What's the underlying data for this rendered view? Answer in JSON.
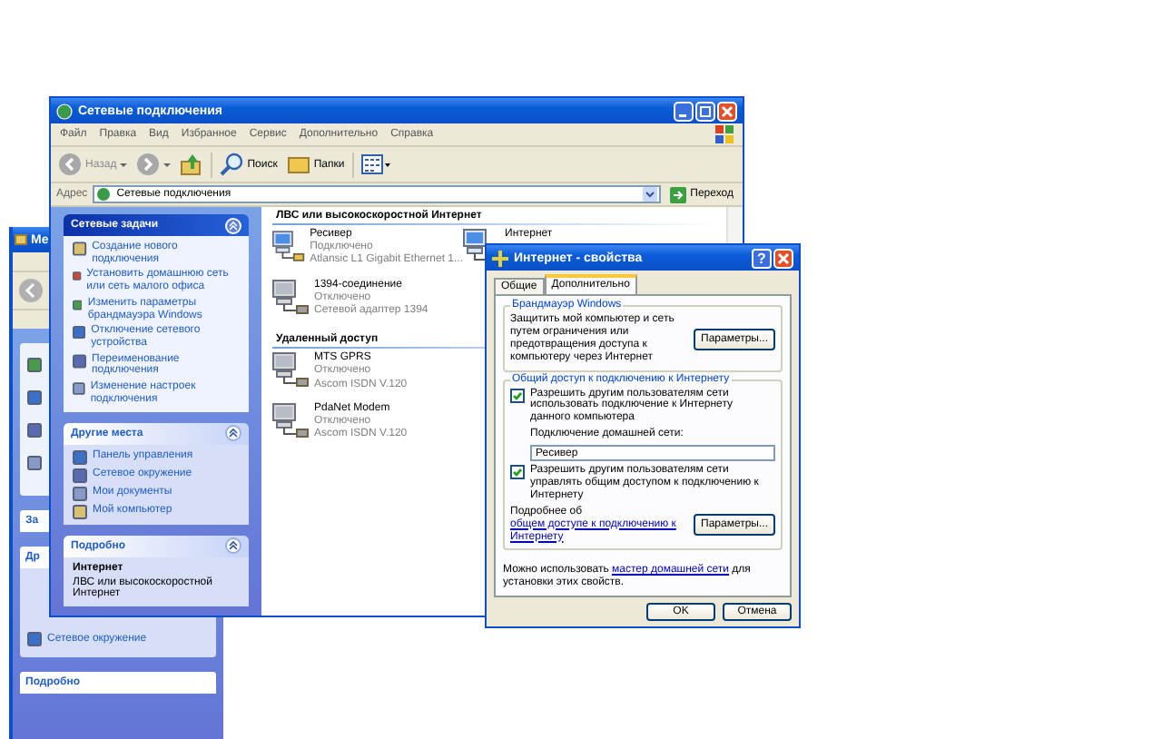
{
  "background_window": {
    "title": "Ме",
    "panels": [
      {
        "title": "За"
      },
      {
        "title": "Др",
        "items": [
          "Сетевое окружение"
        ]
      },
      {
        "title": "Подробно"
      }
    ]
  },
  "window": {
    "title": "Сетевые подключения",
    "menu": [
      "Файл",
      "Правка",
      "Вид",
      "Избранное",
      "Сервис",
      "Дополнительно",
      "Справка"
    ],
    "toolbar": [
      {
        "kind": "back",
        "label": "Назад"
      },
      {
        "kind": "forward"
      },
      {
        "kind": "up"
      },
      {
        "kind": "search",
        "label": "Поиск"
      },
      {
        "kind": "folders",
        "label": "Папки"
      },
      {
        "kind": "views"
      }
    ],
    "address": {
      "label": "Адрес",
      "value": "Сетевые подключения",
      "go": "Переход"
    },
    "sidebar": [
      {
        "kind": "tasks",
        "title": "Сетевые задачи",
        "items": [
          "Создание нового подключения",
          "Установить домашнюю сеть или сеть малого офиса",
          "Изменить параметры брандмауэра Windows",
          "Отключение сетевого устройства",
          "Переименование подключения",
          "Изменение настроек подключения"
        ]
      },
      {
        "kind": "places",
        "title": "Другие места",
        "items": [
          "Панель управления",
          "Сетевое окружение",
          "Мои документы",
          "Мой компьютер"
        ]
      },
      {
        "kind": "details",
        "title": "Подробно",
        "name": "Интернет",
        "description": "ЛВС или высокоскоростной Интернет"
      }
    ],
    "groups": [
      {
        "title": "ЛВС или высокоскоростной Интернет",
        "connections": [
          {
            "name": "Ресивер",
            "status": "Подключено",
            "device": "Atlansic L1 Gigabit Ethernet 1...",
            "connected": true
          },
          {
            "name": "1394-соединение",
            "status": "Отключено",
            "device": "Сетевой адаптер 1394",
            "connected": false
          },
          {
            "name": "Интернет",
            "connected": true
          }
        ]
      },
      {
        "title": "Удаленный доступ",
        "connections": [
          {
            "name": "MTS GPRS",
            "status": "Отключено",
            "device": "Ascom ISDN V.120",
            "connected": false
          },
          {
            "name": "PdaNet Modem",
            "status": "Отключено",
            "device": "Ascom ISDN V.120",
            "connected": false
          }
        ]
      }
    ]
  },
  "dialog": {
    "title": "Интернет - свойства",
    "help_button": "?",
    "tabs": [
      {
        "label": "Общие",
        "selected": false
      },
      {
        "label": "Дополнительно",
        "selected": true
      }
    ],
    "firewall": {
      "title": "Брандмауэр Windows",
      "text": "Защитить мой компьютер и сеть путем ограничения или предотвращения доступа к компьютеру через Интернет",
      "button": "Параметры..."
    },
    "sharing": {
      "title": "Общий доступ к подключению к Интернету",
      "allow_use": {
        "label": "Разрешить другим пользователям сети использовать подключение к Интернету данного компьютера",
        "checked": true
      },
      "home_label": "Подключение домашней сети:",
      "home_value": "Ресивер",
      "allow_control": {
        "label": "Разрешить другим пользователям сети управлять общим доступом к подключению к Интернету",
        "checked": true
      },
      "more_text": "Подробнее об ",
      "more_link": "общем доступе к подключению к Интернету",
      "button": "Параметры..."
    },
    "wizard_text_before": "Можно использовать ",
    "wizard_link": "мастер домашней сети",
    "wizard_text_after": " для установки этих свойств.",
    "buttons": [
      "OK",
      "Отмена"
    ]
  }
}
